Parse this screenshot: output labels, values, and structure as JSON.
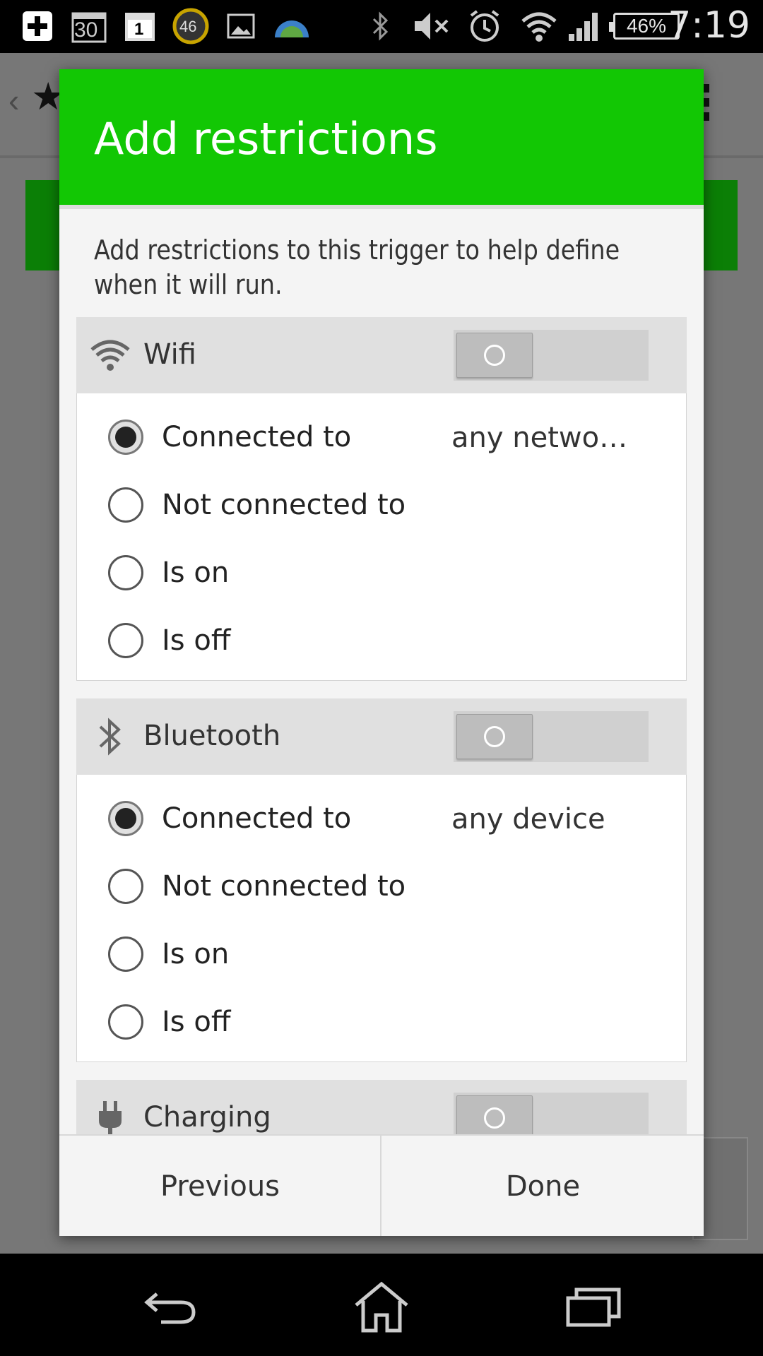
{
  "status_bar": {
    "time": "7:19",
    "battery": "46%",
    "calendar_day": "30",
    "calendar_small": "1",
    "badge_count": "46",
    "icons": [
      "add-icon",
      "calendar-icon",
      "calendar-icon",
      "badge-icon",
      "image-icon",
      "weather-icon",
      "bluetooth-icon",
      "mute-icon",
      "alarm-icon",
      "wifi-icon",
      "signal-icon",
      "battery-icon"
    ]
  },
  "dialog": {
    "title": "Add restrictions",
    "description": "Add restrictions to this trigger to help define when it will run.",
    "header_color": "#12c704",
    "sections": [
      {
        "title": "Wifi",
        "icon": "wifi-icon",
        "enabled": false,
        "value": "any netwo…",
        "options": [
          "Connected to",
          "Not connected to",
          "Is on",
          "Is off"
        ],
        "selected": 0
      },
      {
        "title": "Bluetooth",
        "icon": "bluetooth-icon",
        "enabled": false,
        "value": "any device",
        "options": [
          "Connected to",
          "Not connected to",
          "Is on",
          "Is off"
        ],
        "selected": 0
      },
      {
        "title": "Charging",
        "icon": "plug-icon",
        "enabled": false
      }
    ],
    "footer": {
      "previous_label": "Previous",
      "done_label": "Done"
    }
  },
  "nav_bar": {
    "icons": [
      "back-icon",
      "home-icon",
      "recents-icon"
    ]
  }
}
